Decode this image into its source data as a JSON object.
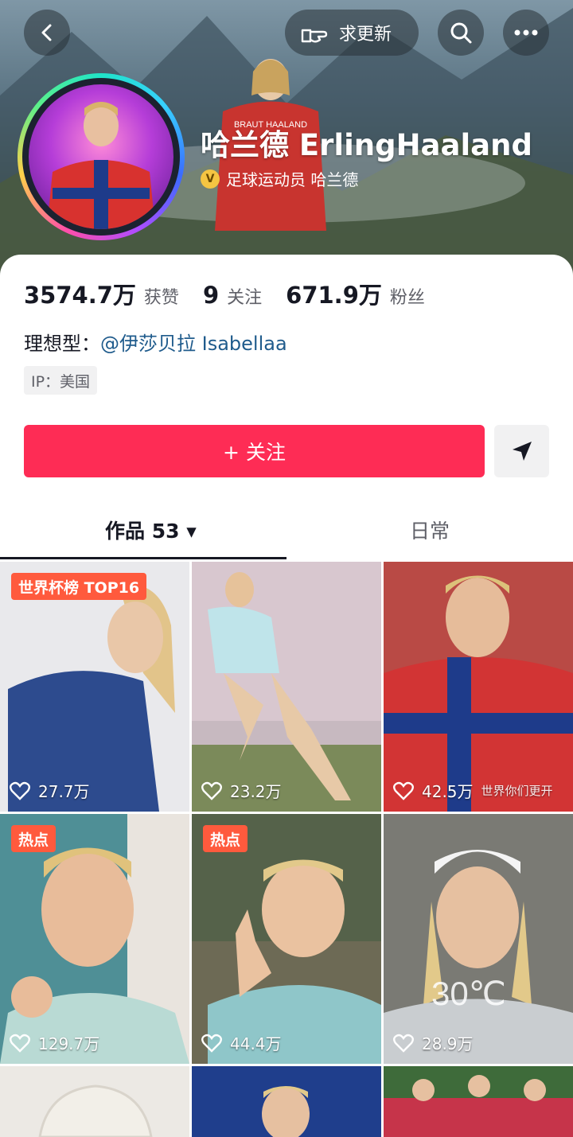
{
  "header": {
    "request_update_label": "求更新",
    "name": "哈兰德 ErlingHaaland",
    "verify_badge": "V",
    "verified_title": "足球运动员 哈兰德",
    "cover_shirt_text": "BRAUT HAALAND"
  },
  "stats": [
    {
      "value": "3574.7万",
      "label": "获赞"
    },
    {
      "value": "9",
      "label": "关注"
    },
    {
      "value": "671.9万",
      "label": "粉丝"
    }
  ],
  "ideal": {
    "prefix": "理想型：",
    "link": "@伊莎贝拉 Isabellaa"
  },
  "ip": "IP：美国",
  "follow_label": "+ 关注",
  "tabs": {
    "works": "作品 53 ▾",
    "daily": "日常"
  },
  "videos": [
    {
      "likes": "27.7万",
      "badge": "世界杯榜 TOP16"
    },
    {
      "likes": "23.2万"
    },
    {
      "likes": "42.5万",
      "overlay": "世界你们更开"
    },
    {
      "likes": "129.7万",
      "badge": "热点"
    },
    {
      "likes": "44.4万",
      "badge": "热点"
    },
    {
      "likes": "28.9万",
      "overlay": "30℃"
    },
    {
      "likes": ""
    },
    {
      "likes": ""
    },
    {
      "likes": ""
    }
  ],
  "colors": {
    "accent": "#fe2c55",
    "hot_badge": "#ff5a3d",
    "link": "#1f5b8c"
  },
  "icons": [
    "back-icon",
    "pointing-hand-icon",
    "search-icon",
    "more-icon",
    "send-icon",
    "heart-icon"
  ]
}
